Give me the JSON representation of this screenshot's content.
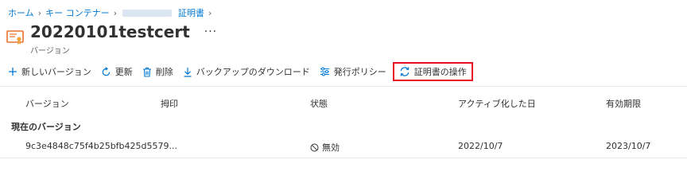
{
  "breadcrumb": {
    "home": "ホーム",
    "key_container": "キー コンテナー",
    "current": "証明書"
  },
  "header": {
    "title": "20220101testcert",
    "more": "···",
    "subtitle": "バージョン"
  },
  "toolbar": {
    "new_version": "新しいバージョン",
    "refresh": "更新",
    "delete": "削除",
    "download_backup": "バックアップのダウンロード",
    "issuance_policy": "発行ポリシー",
    "certificate_operation": "証明書の操作"
  },
  "table": {
    "columns": [
      "バージョン",
      "拇印",
      "状態",
      "アクティブ化した日",
      "有効期限"
    ],
    "group_label": "現在のバージョン",
    "rows": [
      {
        "version": "9c3e4848c75f4b25bfb425d5579...",
        "thumbprint": "",
        "status": "無効",
        "activated": "2022/10/7",
        "expires": "2023/10/7"
      }
    ]
  },
  "colors": {
    "link": "#0078d4",
    "highlight_border": "#e81123",
    "cert_icon": "#e8722c"
  },
  "icons": {
    "cert": "certificate-icon",
    "add": "plus-icon",
    "refresh": "refresh-icon",
    "delete": "trash-icon",
    "download": "download-icon",
    "policy": "sliders-icon",
    "operation": "sync-icon",
    "disabled": "blocked-icon"
  }
}
